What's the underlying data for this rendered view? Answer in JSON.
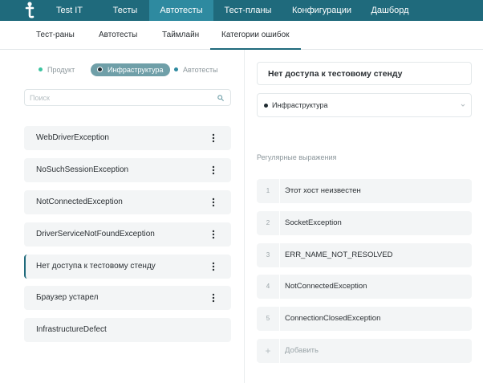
{
  "app": {
    "name": "Test IT"
  },
  "topnav": [
    {
      "label": "Тесты",
      "active": false
    },
    {
      "label": "Автотесты",
      "active": true
    },
    {
      "label": "Тест-планы",
      "active": false
    },
    {
      "label": "Конфигурации",
      "active": false
    },
    {
      "label": "Дашборд",
      "active": false
    }
  ],
  "subnav": [
    {
      "label": "Тест-раны",
      "active": false
    },
    {
      "label": "Автотесты",
      "active": false
    },
    {
      "label": "Таймлайн",
      "active": false
    },
    {
      "label": "Категории ошибок",
      "active": true
    }
  ],
  "filters": [
    {
      "label": "Продукт",
      "dot_color": "#3cc4a0",
      "active": false
    },
    {
      "label": "Инфраструктура",
      "dot_color": "#1e2a30",
      "active": true
    },
    {
      "label": "Автотесты",
      "dot_color": "#2e8aa0",
      "active": false
    }
  ],
  "search": {
    "placeholder": "Поиск"
  },
  "categories": [
    {
      "label": "WebDriverException",
      "menu": true,
      "selected": false
    },
    {
      "label": "NoSuchSessionException",
      "menu": true,
      "selected": false
    },
    {
      "label": "NotConnectedException",
      "menu": true,
      "selected": false
    },
    {
      "label": "DriverServiceNotFoundException",
      "menu": true,
      "selected": false
    },
    {
      "label": "Нет доступа к тестовому стенду",
      "menu": true,
      "selected": true
    },
    {
      "label": "Браузер устарел",
      "menu": true,
      "selected": false
    },
    {
      "label": "InfrastructureDefect",
      "menu": false,
      "selected": false
    }
  ],
  "detail": {
    "title": "Нет доступа к тестовому стенду",
    "category": "Инфраструктура",
    "regex_label": "Регулярные выражения",
    "regexes": [
      {
        "num": "1",
        "text": "Этот хост неизвестен"
      },
      {
        "num": "2",
        "text": "SocketException"
      },
      {
        "num": "3",
        "text": "ERR_NAME_NOT_RESOLVED"
      },
      {
        "num": "4",
        "text": "NotConnectedException"
      },
      {
        "num": "5",
        "text": "ConnectionClosedException"
      }
    ],
    "add": {
      "num": "+",
      "text": "Добавить"
    }
  },
  "colors": {
    "header": "#1f6a7c",
    "header_active": "#2e8aa0",
    "item_bg": "#f3f5f6"
  }
}
